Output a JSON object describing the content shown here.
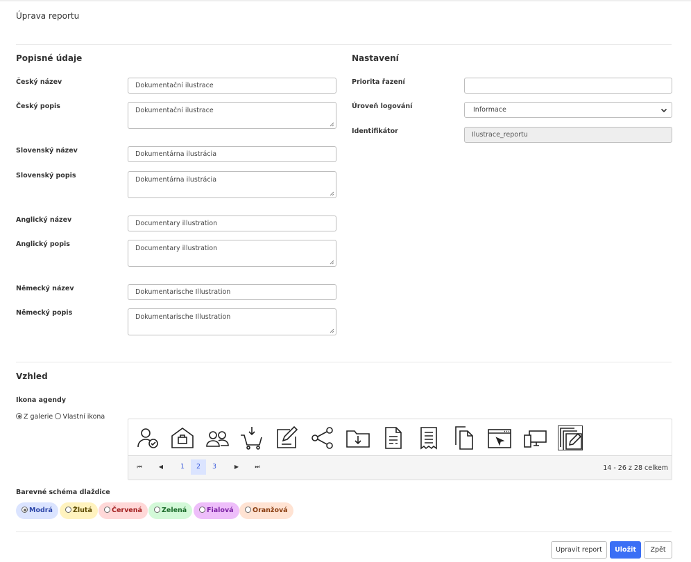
{
  "page_title": "Úprava reportu",
  "descriptive": {
    "title": "Popisné údaje",
    "fields": [
      {
        "label": "Český název",
        "value": "Dokumentační ilustrace"
      },
      {
        "label": "Český popis",
        "value": "Dokumentační ilustrace"
      },
      {
        "label": "Slovenský název",
        "value": "Dokumentárna ilustrácia"
      },
      {
        "label": "Slovenský popis",
        "value": "Dokumentárna ilustrácia"
      },
      {
        "label": "Anglický název",
        "value": "Documentary illustration"
      },
      {
        "label": "Anglický popis",
        "value": "Documentary illustration"
      },
      {
        "label": "Německý název",
        "value": "Dokumentarische Illustration"
      },
      {
        "label": "Německý popis",
        "value": "Dokumentarische Illustration"
      }
    ]
  },
  "settings": {
    "title": "Nastavení",
    "priority_label": "Priorita řazení",
    "priority_value": "",
    "log_label": "Úroveň logování",
    "log_value": "Informace",
    "id_label": "Identifikátor",
    "id_value": "Ilustrace_reportu"
  },
  "appearance": {
    "title": "Vzhled",
    "icon_label": "Ikona agendy",
    "icon_source_gallery": "Z galerie",
    "icon_source_custom": "Vlastní ikona",
    "icons": [
      "user-check-icon",
      "home-work-icon",
      "users-icon",
      "cart-download-icon",
      "edit-note-icon",
      "share-icon",
      "folder-download-icon",
      "document-icon",
      "receipt-icon",
      "copy-icon",
      "browser-cursor-icon",
      "devices-icon",
      "edit-copy-icon"
    ],
    "pager": {
      "first": "⏮",
      "prev": "◀",
      "next": "▶",
      "last": "⏭",
      "pages": [
        "1",
        "2",
        "3"
      ],
      "info": "14 - 26 z 28 celkem"
    },
    "scheme_label": "Barevné schéma dlaždice",
    "schemes": [
      {
        "label": "Modrá",
        "bg": "#dbe4ff",
        "fg": "#2b45a8",
        "checked": true
      },
      {
        "label": "Žlutá",
        "bg": "#fff3bf",
        "fg": "#5c4a00"
      },
      {
        "label": "Červená",
        "bg": "#ffd8d8",
        "fg": "#a32020"
      },
      {
        "label": "Zelená",
        "bg": "#d3f9d8",
        "fg": "#1b6b2a"
      },
      {
        "label": "Fialová",
        "bg": "#eebefa",
        "fg": "#7a1fa3"
      },
      {
        "label": "Oranžová",
        "bg": "#ffe3d3",
        "fg": "#8a3d10"
      }
    ]
  },
  "buttons": {
    "edit": "Upravit report",
    "save": "Uložit",
    "back": "Zpět"
  },
  "colors": {
    "primary": "#3b6ff5",
    "pager_active": "#dbe4ff"
  }
}
